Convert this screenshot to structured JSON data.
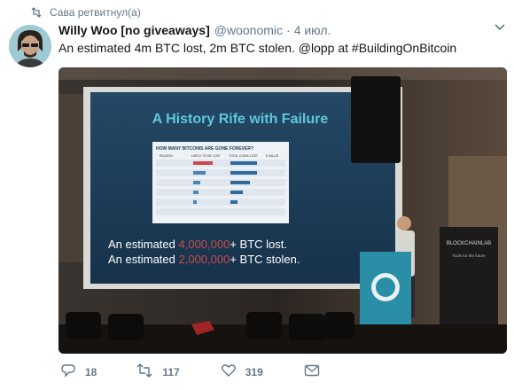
{
  "retweet": {
    "label": "Сава ретвитнул(а)"
  },
  "tweet": {
    "display_name": "Willy Woo [no giveaways]",
    "handle": "@woonomic",
    "separator": "·",
    "timestamp": "4 июл.",
    "text_plain": "An estimated 4m BTC lost, 2m BTC stolen.",
    "mention": "@lopp",
    "text_at": "at",
    "hashtag": "#BuildingOnBitcoin"
  },
  "media": {
    "slide_title": "A History Rife with Failure",
    "table_title": "HOW MANY BITCOINS ARE GONE FOREVER?",
    "table_headers": [
      "REASON",
      "LIKELY TO BE LOST",
      "TOTAL COINS LOST",
      "$ VALUE"
    ],
    "slide_line1_prefix": "An estimated",
    "slide_line1_number": "4,000,000",
    "slide_line1_suffix": "+ BTC lost.",
    "slide_line2_prefix": "An estimated",
    "slide_line2_number": "2,000,000",
    "slide_line2_suffix": "+ BTC stolen.",
    "banner_text": "BLOCKCHAINLAB",
    "banner_subtext": "Tools for the future"
  },
  "actions": {
    "reply_count": "18",
    "retweet_count": "117",
    "like_count": "319"
  },
  "colors": {
    "text": "#14171a",
    "muted": "#657786",
    "slide_bg": "#1e3c55",
    "slide_title": "#5ec8dc",
    "slide_highlight": "#c84a4a",
    "podium": "#2a8ea6"
  },
  "icons": [
    "retweet-icon",
    "chevron-down-icon",
    "reply-icon",
    "retweet-icon",
    "heart-icon",
    "message-icon"
  ]
}
